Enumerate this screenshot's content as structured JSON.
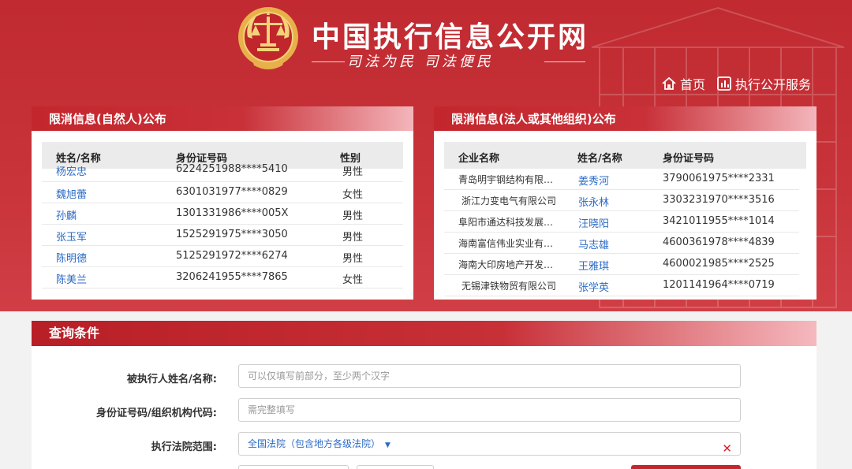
{
  "header": {
    "site_title": "中国执行信息公开网",
    "slogan": "司法为民  司法便民"
  },
  "nav": [
    {
      "label": "首页",
      "icon": "home-icon"
    },
    {
      "label": "执行公开服务",
      "icon": "service-icon"
    }
  ],
  "panel_person": {
    "title": "限消信息(自然人)公布",
    "columns": [
      "姓名/名称",
      "身份证号码",
      "性别"
    ],
    "rows": [
      {
        "name": "杨宏忠",
        "id": "6224251988****5410",
        "gender": "男性"
      },
      {
        "name": "魏旭蕾",
        "id": "6301031977****0829",
        "gender": "女性"
      },
      {
        "name": "孙麟",
        "id": "1301331986****005X",
        "gender": "男性"
      },
      {
        "name": "张玉军",
        "id": "1525291975****3050",
        "gender": "男性"
      },
      {
        "name": "陈明德",
        "id": "5125291972****6274",
        "gender": "男性"
      },
      {
        "name": "陈美兰",
        "id": "3206241955****7865",
        "gender": "女性"
      }
    ]
  },
  "panel_org": {
    "title": "限消信息(法人或其他组织)公布",
    "columns": [
      "企业名称",
      "姓名/名称",
      "身份证号码"
    ],
    "rows": [
      {
        "company": "青岛明宇钢结构有限…",
        "name": "姜秀河",
        "id": "3790061975****2331"
      },
      {
        "company": "浙江力变电气有限公司",
        "name": "张永林",
        "id": "3303231970****3516"
      },
      {
        "company": "阜阳市通达科技发展…",
        "name": "汪晓阳",
        "id": "3421011955****1014"
      },
      {
        "company": "海南富信伟业实业有…",
        "name": "马志雄",
        "id": "4600361978****4839"
      },
      {
        "company": "海南大印房地产开发…",
        "name": "王雅琪",
        "id": "4600021985****2525"
      },
      {
        "company": "无锡津铁物贸有限公司",
        "name": "张学英",
        "id": "1201141964****0719"
      }
    ]
  },
  "query": {
    "title": "查询条件",
    "name_label": "被执行人姓名/名称:",
    "name_placeholder": "可以仅填写前部分，至少两个汉字",
    "id_label": "身份证号码/组织机构代码:",
    "id_placeholder": "需完整填写",
    "court_label": "执行法院范围:",
    "court_value": "全国法院（包含地方各级法院）"
  },
  "colors": {
    "brand_red": "#c4262d",
    "link_blue": "#2c6bc6"
  }
}
